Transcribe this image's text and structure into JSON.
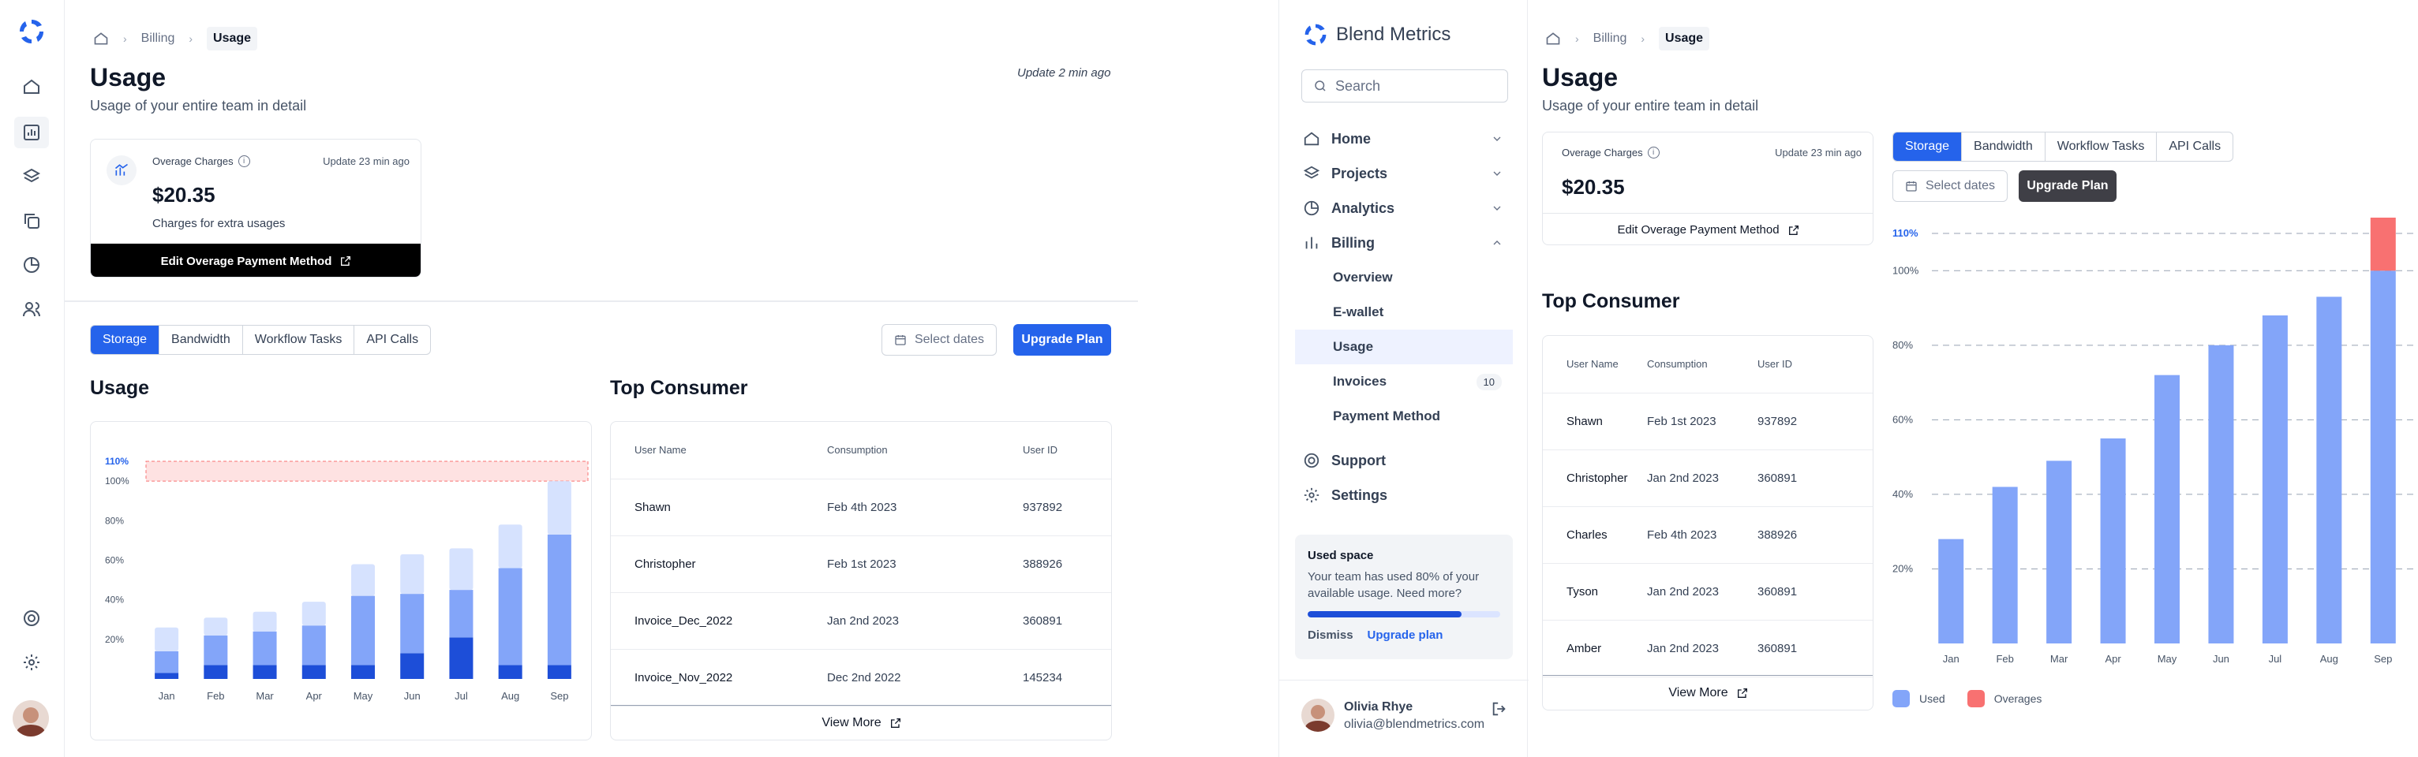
{
  "brand": {
    "name": "Blend Metrics"
  },
  "breadcrumb": {
    "items": [
      "Billing",
      "Usage"
    ]
  },
  "page": {
    "title": "Usage",
    "subtitle": "Usage of your entire team in detail",
    "update": "Update 2 min ago"
  },
  "overage": {
    "label": "Overage Charges",
    "update": "Update 23 min ago",
    "amount": "$20.35",
    "note": "Charges for extra usages",
    "edit_btn": "Edit Overage Payment Method"
  },
  "tabs": [
    "Storage",
    "Bandwidth",
    "Workflow Tasks",
    "API Calls"
  ],
  "actions": {
    "select_dates": "Select dates",
    "upgrade": "Upgrade Plan"
  },
  "left_usage": {
    "title": "Usage"
  },
  "consumer": {
    "title": "Top Consumer",
    "columns": [
      "User Name",
      "Consumption",
      "User ID"
    ],
    "rows_left": [
      [
        "Shawn",
        "Feb 4th 2023",
        "937892"
      ],
      [
        "Christopher",
        "Feb 1st 2023",
        "388926"
      ],
      [
        "Invoice_Dec_2022",
        "Jan 2nd 2023",
        "360891"
      ],
      [
        "Invoice_Nov_2022",
        "Dec 2nd 2022",
        "145234"
      ]
    ],
    "rows_right": [
      [
        "Shawn",
        "Feb 1st 2023",
        "937892"
      ],
      [
        "Christopher",
        "Jan 2nd 2023",
        "360891"
      ],
      [
        "Charles",
        "Feb 4th 2023",
        "388926"
      ],
      [
        "Tyson",
        "Jan 2nd 2023",
        "360891"
      ],
      [
        "Amber",
        "Jan 2nd 2023",
        "360891"
      ]
    ],
    "view_more": "View More"
  },
  "sidebar": {
    "search_placeholder": "Search",
    "items": [
      "Home",
      "Projects",
      "Analytics",
      "Billing"
    ],
    "billing_sub": [
      "Overview",
      "E-wallet",
      "Usage",
      "Invoices",
      "Payment Method"
    ],
    "invoices_badge": "10",
    "bottom": [
      "Support",
      "Settings"
    ],
    "space": {
      "title": "Used space",
      "text1": "Your team has used 80% of your",
      "text2": "available usage. Need more?",
      "progress": 0.8,
      "dismiss": "Dismiss",
      "upgrade": "Upgrade plan"
    },
    "user": {
      "name": "Olivia Rhye",
      "email": "olivia@blendmetrics.com"
    }
  },
  "colors": {
    "accent": "#2563eb",
    "used": "#83a5f9",
    "overage": "#f87171"
  },
  "chart_data": [
    {
      "type": "bar",
      "stacked": true,
      "categories": [
        "Jan",
        "Feb",
        "Mar",
        "Apr",
        "May",
        "Jun",
        "Jul",
        "Aug",
        "Sep"
      ],
      "yticks": [
        "110%",
        "100%",
        "80%",
        "60%",
        "40%",
        "20%"
      ],
      "ylim": [
        0,
        110
      ],
      "series": [
        {
          "values": [
            3,
            7,
            7,
            7,
            7,
            13,
            21,
            7,
            7
          ]
        },
        {
          "values": [
            11,
            15,
            17,
            20,
            35,
            30,
            24,
            49,
            66
          ]
        },
        {
          "values": [
            12,
            9,
            10,
            12,
            16,
            20,
            21,
            22,
            27
          ]
        }
      ],
      "threshold_band": [
        100,
        110
      ]
    },
    {
      "type": "bar",
      "stacked": true,
      "categories": [
        "Jan",
        "Feb",
        "Mar",
        "Apr",
        "May",
        "Jun",
        "Jul",
        "Aug",
        "Sep"
      ],
      "yticks": [
        "110%",
        "100%",
        "80%",
        "60%",
        "40%",
        "20%"
      ],
      "ylim": [
        0,
        110
      ],
      "series": [
        {
          "name": "Used",
          "values": [
            28,
            42,
            49,
            55,
            72,
            80,
            88,
            93,
            100
          ]
        },
        {
          "name": "Overages",
          "values": [
            0,
            0,
            0,
            0,
            0,
            0,
            0,
            0,
            20
          ]
        }
      ],
      "legend": "bottom-left"
    }
  ]
}
